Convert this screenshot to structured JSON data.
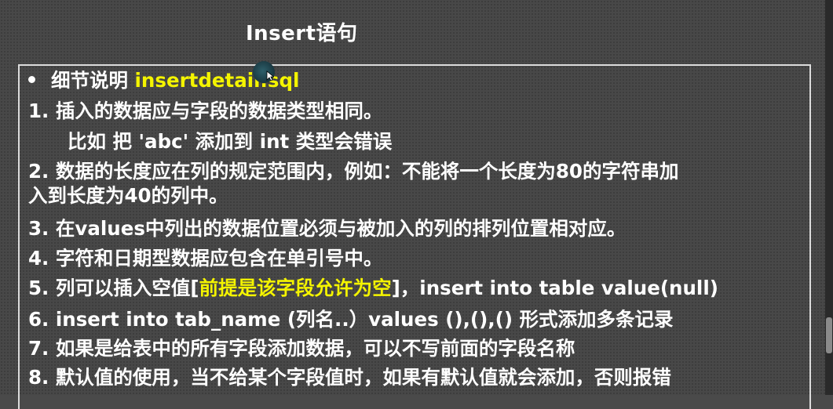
{
  "title": "Insert语句",
  "bullet": {
    "label": "细节说明 ",
    "file": "insertdetail.sql"
  },
  "items": {
    "i1": "1. 插入的数据应与字段的数据类型相同。",
    "i1_example": "比如 把 'abc' 添加到 int 类型会错误",
    "i2_a": "2. 数据的长度应在列的规定范围内，例如：不能将一个长度为80的字符串加",
    "i2_b": "入到长度为40的列中。",
    "i3": "3. 在values中列出的数据位置必须与被加入的列的排列位置相对应。",
    "i4": "4. 字符和日期型数据应包含在单引号中。",
    "i5_pre": "5. 列可以插入空值[",
    "i5_hl": "前提是该字段允许为空",
    "i5_post": "]，insert into table value(null)",
    "i6": "6. insert into tab_name (列名..）values (),(),()  形式添加多条记录",
    "i7": "7. 如果是给表中的所有字段添加数据，可以不写前面的字段名称",
    "i8": "8. 默认值的使用，当不给某个字段值时，如果有默认值就会添加，否则报错"
  },
  "colors": {
    "background": "#484848",
    "text": "#ffffff",
    "highlight": "#f4f400"
  }
}
